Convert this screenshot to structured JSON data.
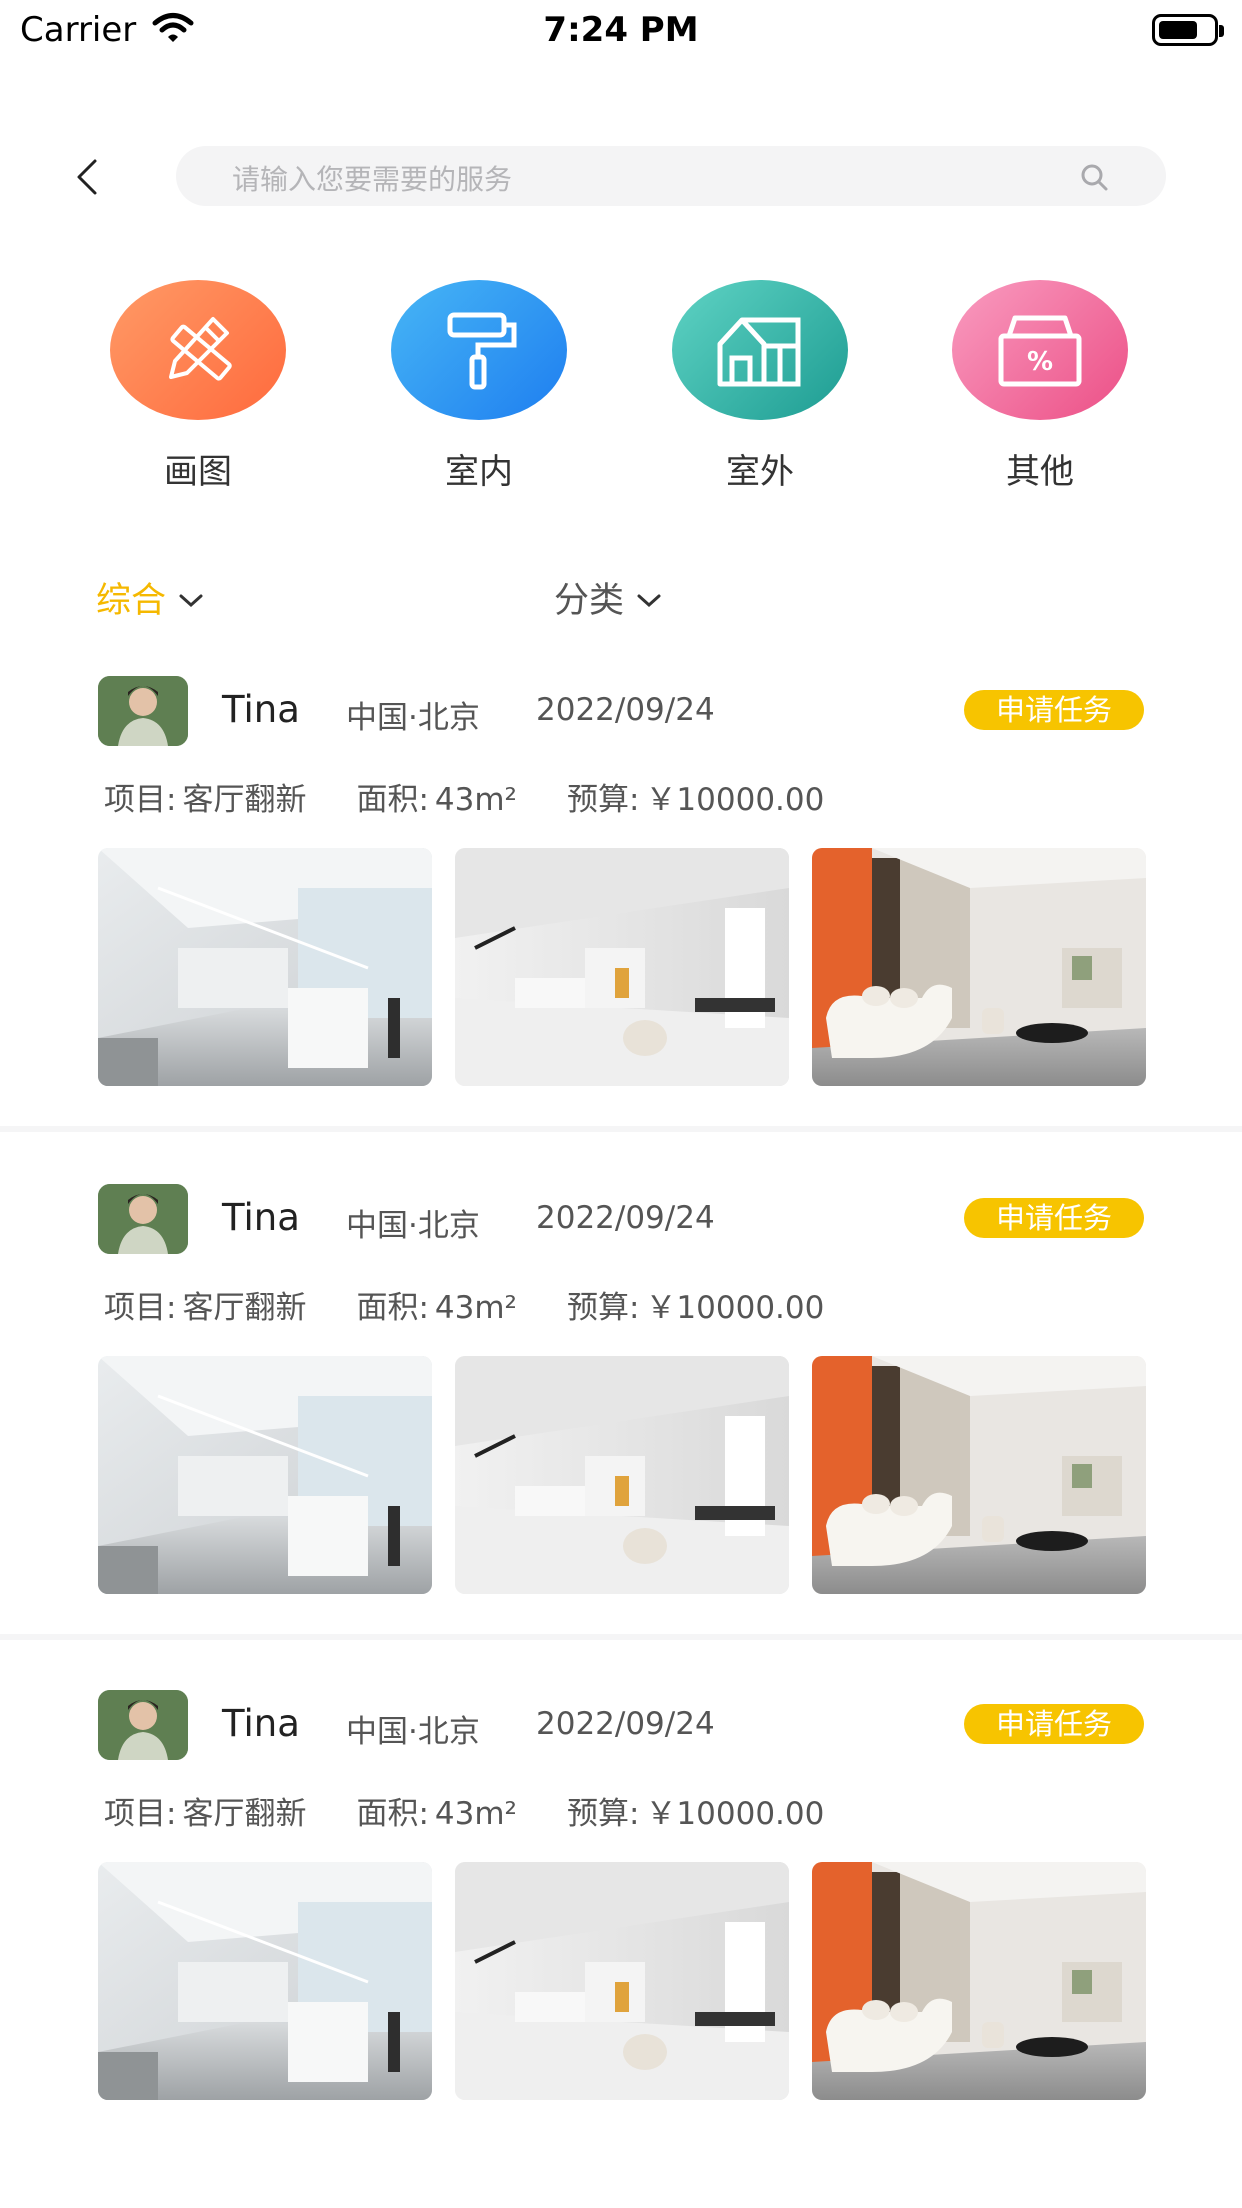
{
  "status_bar": {
    "carrier": "Carrier",
    "time": "7:24 PM"
  },
  "search": {
    "placeholder": "请输入您要需要的服务"
  },
  "categories": [
    {
      "label": "画图",
      "icon": "pencil-ruler-icon",
      "color": "#ff7a45"
    },
    {
      "label": "室内",
      "icon": "paint-roller-icon",
      "color": "#2b8cf3"
    },
    {
      "label": "室外",
      "icon": "house-icon",
      "color": "#2bb3a6"
    },
    {
      "label": "其他",
      "icon": "discount-box-icon",
      "color": "#f06a97"
    }
  ],
  "filters": {
    "sort_label": "综合",
    "category_label": "分类"
  },
  "accent_color": "#f5b800",
  "posts": [
    {
      "user": "Tina",
      "location": "中国·北京",
      "date": "2022/09/24",
      "action": "申请任务",
      "project_label": "项目:",
      "project": "客厅翻新",
      "area_label": "面积:",
      "area": "43m²",
      "budget_label": "预算:",
      "budget": "￥10000.00"
    },
    {
      "user": "Tina",
      "location": "中国·北京",
      "date": "2022/09/24",
      "action": "申请任务",
      "project_label": "项目:",
      "project": "客厅翻新",
      "area_label": "面积:",
      "area": "43m²",
      "budget_label": "预算:",
      "budget": "￥10000.00"
    },
    {
      "user": "Tina",
      "location": "中国·北京",
      "date": "2022/09/24",
      "action": "申请任务",
      "project_label": "项目:",
      "project": "客厅翻新",
      "area_label": "面积:",
      "area": "43m²",
      "budget_label": "预算:",
      "budget": "￥10000.00"
    }
  ]
}
